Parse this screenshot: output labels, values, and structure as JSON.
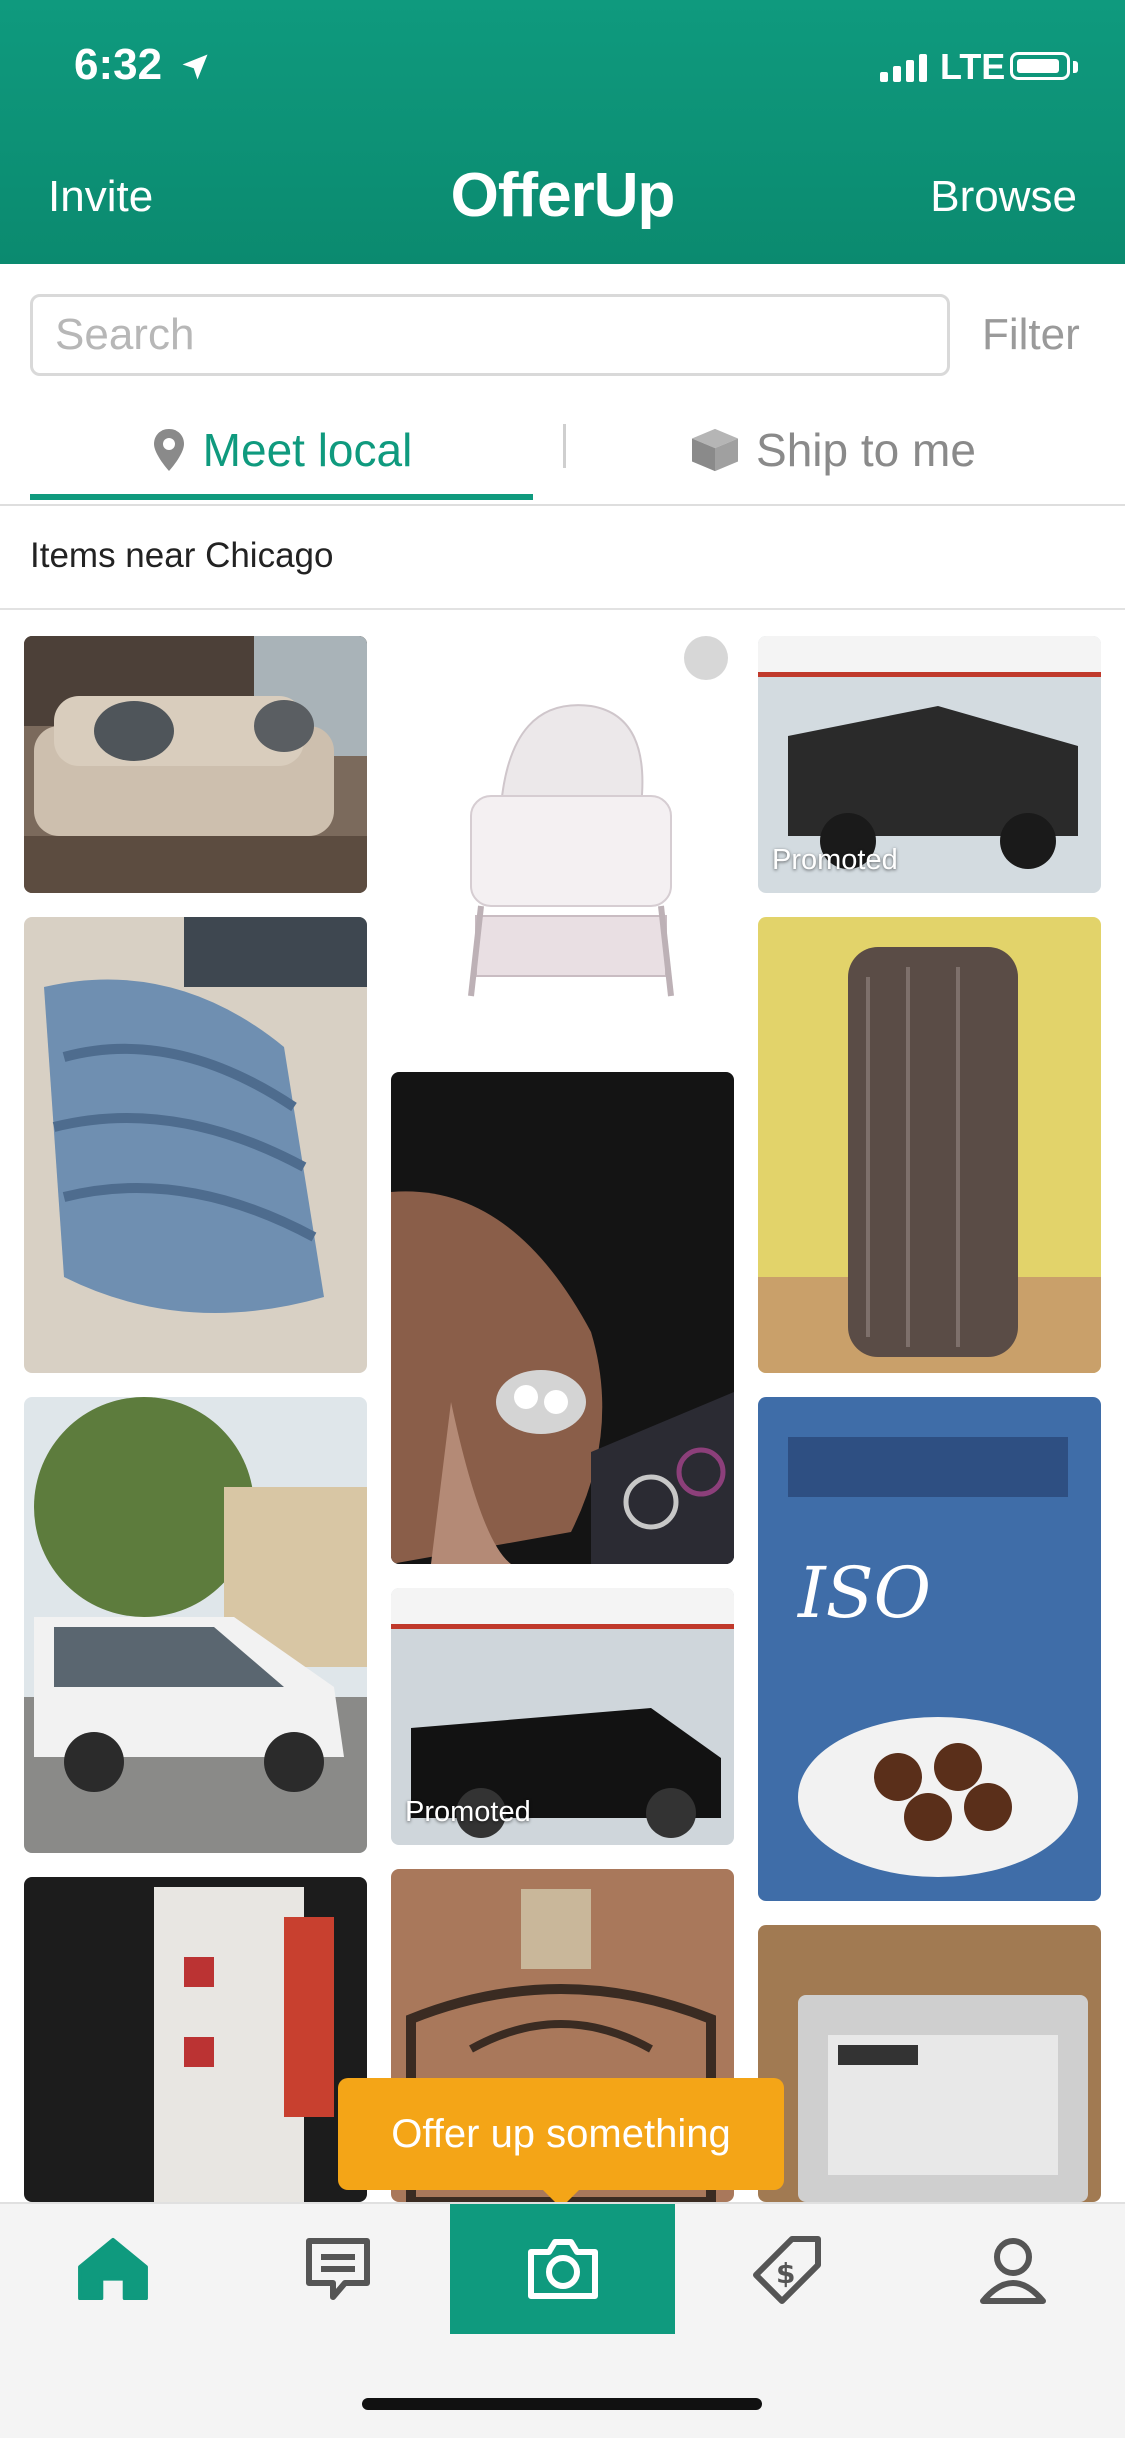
{
  "status": {
    "time": "6:32",
    "network": "LTE"
  },
  "nav": {
    "invite": "Invite",
    "logo": "OfferUp",
    "browse": "Browse"
  },
  "search": {
    "placeholder": "Search",
    "filter": "Filter"
  },
  "tabs": {
    "local": "Meet local",
    "ship": "Ship to me"
  },
  "feed": {
    "heading": "Items near Chicago",
    "promoted": "Promoted"
  },
  "cta": {
    "tooltip": "Offer up something"
  },
  "colors": {
    "brand": "#0f9a7e",
    "cta": "#f4a517"
  },
  "icons": {
    "tabbar": [
      "home-icon",
      "messages-icon",
      "camera-icon",
      "selling-tag-icon",
      "account-icon"
    ]
  }
}
